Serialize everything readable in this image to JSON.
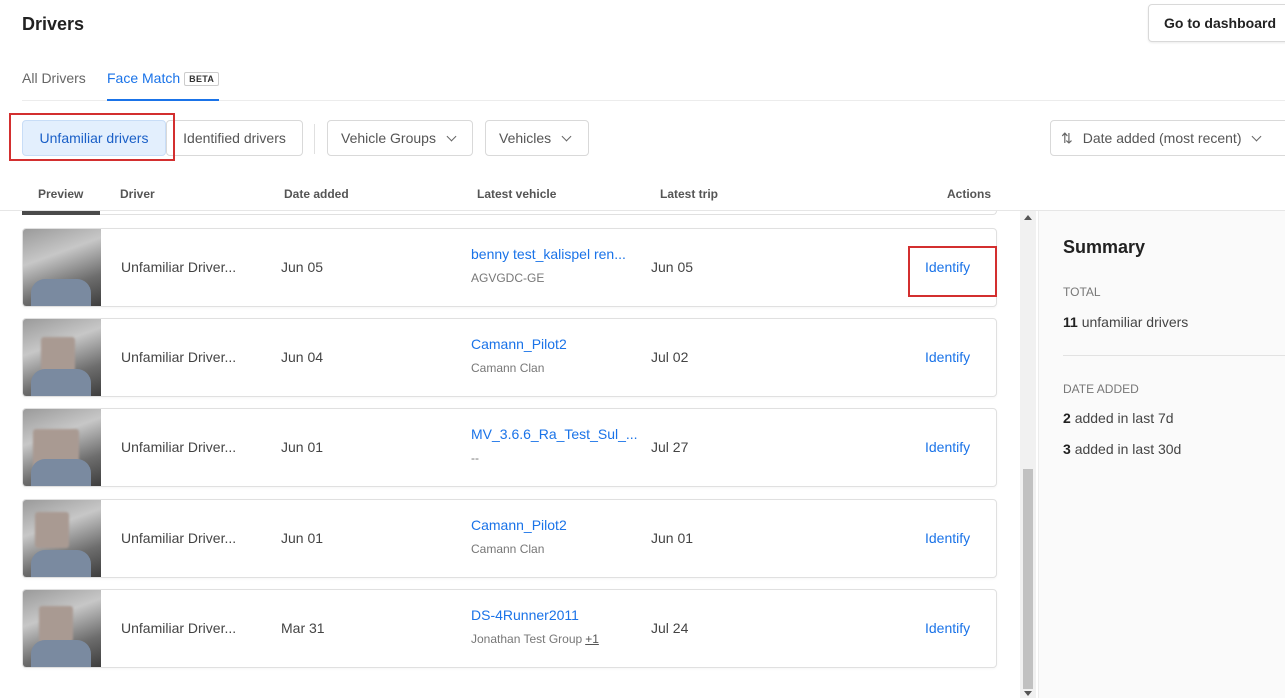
{
  "header": {
    "title": "Drivers",
    "dashboard_button": "Go to dashboard"
  },
  "tabs": [
    {
      "label": "All Drivers"
    },
    {
      "label": "Face Match",
      "badge": "BETA"
    }
  ],
  "filters": {
    "unfamiliar_label": "Unfamiliar drivers",
    "identified_label": "Identified drivers",
    "vehicle_groups_label": "Vehicle Groups",
    "vehicles_label": "Vehicles",
    "sort_label": "Date added (most recent)"
  },
  "columns": {
    "preview": "Preview",
    "driver": "Driver",
    "date_added": "Date added",
    "latest_vehicle": "Latest vehicle",
    "latest_trip": "Latest trip",
    "actions": "Actions"
  },
  "rows": [
    {
      "driver": "Unfamiliar Driver...",
      "date_added": "Jun 05",
      "vehicle": "benny test_kalispel ren...",
      "vehicle_sub": "AGVGDC-GE",
      "latest_trip": "Jun 05",
      "action": "Identify"
    },
    {
      "driver": "Unfamiliar Driver...",
      "date_added": "Jun 04",
      "vehicle": "Camann_Pilot2",
      "vehicle_sub": "Camann Clan",
      "latest_trip": "Jul 02",
      "action": "Identify"
    },
    {
      "driver": "Unfamiliar Driver...",
      "date_added": "Jun 01",
      "vehicle": "MV_3.6.6_Ra_Test_Sul_...",
      "vehicle_sub": "--",
      "latest_trip": "Jul 27",
      "action": "Identify"
    },
    {
      "driver": "Unfamiliar Driver...",
      "date_added": "Jun 01",
      "vehicle": "Camann_Pilot2",
      "vehicle_sub": "Camann Clan",
      "latest_trip": "Jun 01",
      "action": "Identify"
    },
    {
      "driver": "Unfamiliar Driver...",
      "date_added": "Mar 31",
      "vehicle": "DS-4Runner2011",
      "vehicle_sub": "Jonathan Test Group",
      "vehicle_sub_extra": "+1",
      "latest_trip": "Jul 24",
      "action": "Identify"
    }
  ],
  "summary": {
    "title": "Summary",
    "total_label": "TOTAL",
    "total_count": "11",
    "total_text": "unfamiliar drivers",
    "date_added_label": "DATE ADDED",
    "last7_count": "2",
    "last7_text": "added in last 7d",
    "last30_count": "3",
    "last30_text": "added in last 30d"
  },
  "icons": {
    "sort": "sort-arrows-icon",
    "dropdown": "chevron-down-icon"
  },
  "colors": {
    "accent": "#1a73e8",
    "highlight": "#d32f2f",
    "selected_segment_bg": "#e3effd"
  }
}
